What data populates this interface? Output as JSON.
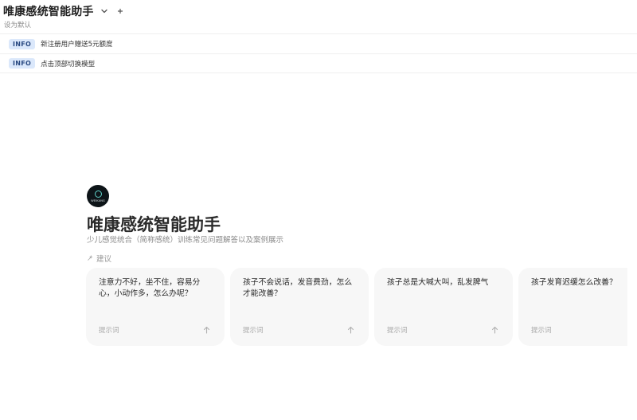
{
  "header": {
    "title": "唯康感统智能助手",
    "set_default": "设为默认",
    "dropdown_icon": "chevron-down-icon",
    "add_icon": "plus-icon"
  },
  "notices": [
    {
      "badge": "INFO",
      "text": "新注册用户赠送5元额度"
    },
    {
      "badge": "INFO",
      "text": "点击顶部切换模型"
    }
  ],
  "assistant": {
    "avatar_text": "WEIKANG",
    "name": "唯康感统智能助手",
    "description": "少儿感觉统合（简称感统）训练常见问题解答以及案例展示"
  },
  "suggestions": {
    "label": "建议",
    "icon": "sparkle-icon",
    "cards": [
      {
        "question": "注意力不好，坐不住，容易分心，小动作多，怎么办呢？",
        "tag": "提示词"
      },
      {
        "question": "孩子不会说话，发音费劲，怎么才能改善？",
        "tag": "提示词"
      },
      {
        "question": "孩子总是大喊大叫，乱发脾气",
        "tag": "提示词"
      },
      {
        "question": "孩子发育迟缓怎么改善？",
        "tag": "提示词"
      }
    ]
  },
  "colors": {
    "badge_bg": "#dbe8fb",
    "badge_text": "#2a4a82",
    "card_bg": "#f7f7f7",
    "avatar_bg": "#0d1418",
    "avatar_accent": "#5fd0c8"
  }
}
